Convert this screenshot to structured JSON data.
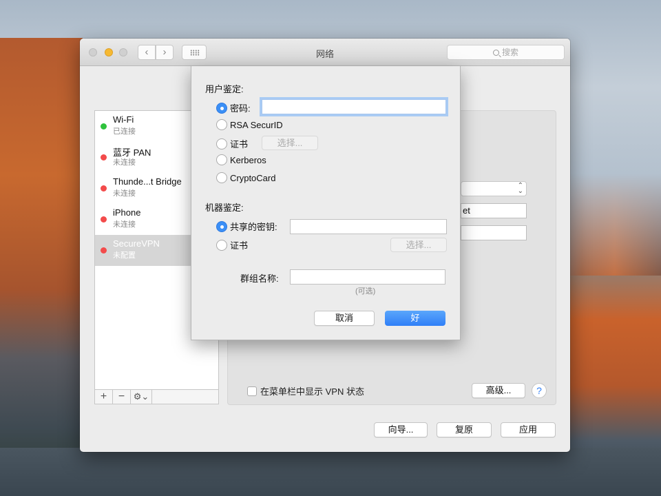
{
  "window": {
    "title": "网络",
    "search_placeholder": "搜索",
    "nav_back": "‹",
    "nav_forward": "›"
  },
  "sidebar": {
    "services": [
      {
        "name": "Wi-Fi",
        "status": "已连接",
        "color": "#2fc23d"
      },
      {
        "name": "蓝牙 PAN",
        "status": "未连接",
        "color": "#f34b4b"
      },
      {
        "name": "Thunde...t Bridge",
        "status": "未连接",
        "color": "#f34b4b"
      },
      {
        "name": "iPhone",
        "status": "未连接",
        "color": "#f34b4b"
      },
      {
        "name": "SecureVPN",
        "status": "未配置",
        "color": "#f34b4b",
        "selected": true
      }
    ],
    "add_label": "+",
    "remove_label": "−",
    "gear_label": "⚙⌄"
  },
  "detail": {
    "partial_field_text": "et",
    "show_vpn_status_label": "在菜单栏中显示 VPN 状态",
    "show_vpn_status_checked": false,
    "advanced_label": "高级...",
    "help_label": "?"
  },
  "footer": {
    "assist_label": "向导...",
    "revert_label": "复原",
    "apply_label": "应用"
  },
  "sheet": {
    "user_auth_label": "用户鉴定:",
    "user_auth_options": [
      {
        "label": "密码:",
        "selected": true
      },
      {
        "label": "RSA SecurID",
        "selected": false
      },
      {
        "label": "证书",
        "selected": false
      },
      {
        "label": "Kerberos",
        "selected": false
      },
      {
        "label": "CryptoCard",
        "selected": false
      }
    ],
    "password_value": "",
    "user_cert_select_label": "选择...",
    "machine_auth_label": "机器鉴定:",
    "machine_auth_options": [
      {
        "label": "共享的密钥:",
        "selected": true
      },
      {
        "label": "证书",
        "selected": false
      }
    ],
    "shared_secret_value": "",
    "machine_cert_select_label": "选择...",
    "group_name_label": "群组名称:",
    "group_name_value": "",
    "optional_hint": "(可选)",
    "cancel_label": "取消",
    "ok_label": "好"
  }
}
